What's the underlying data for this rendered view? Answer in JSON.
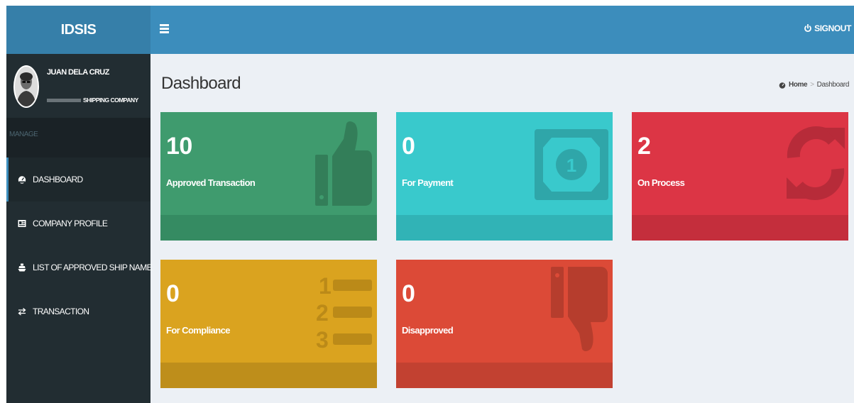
{
  "header": {
    "logo": "IDSIS",
    "signout_label": "SIGNOUT"
  },
  "user": {
    "name": "JUAN DELA CRUZ",
    "company": "SHIPPING COMPANY"
  },
  "sidebar": {
    "section_header": "MANAGE",
    "items": [
      {
        "label": "DASHBOARD",
        "icon": "dashboard-icon",
        "active": true
      },
      {
        "label": "COMPANY PROFILE",
        "icon": "profile-card-icon",
        "active": false
      },
      {
        "label": "LIST OF APPROVED SHIP NAME",
        "icon": "ship-icon",
        "active": false
      },
      {
        "label": "TRANSACTION",
        "icon": "exchange-icon",
        "active": false
      }
    ]
  },
  "content": {
    "title": "Dashboard",
    "breadcrumb": {
      "home": "Home",
      "current": "Dashboard"
    }
  },
  "boxes": [
    {
      "count": "10",
      "label": "Approved Transaction",
      "icon": "thumbs-up-icon",
      "color": "#3f9b6e"
    },
    {
      "count": "0",
      "label": "For Payment",
      "icon": "money-icon",
      "color": "#39c9cc"
    },
    {
      "count": "2",
      "label": "On Process",
      "icon": "refresh-icon",
      "color": "#dc3545"
    },
    {
      "count": "0",
      "label": "For Compliance",
      "icon": "ordered-list-icon",
      "color": "#daa31f"
    },
    {
      "count": "0",
      "label": "Disapproved",
      "icon": "thumbs-down-icon",
      "color": "#dc4a37"
    }
  ],
  "colors": {
    "header": "#3c8dbc",
    "logo_bg": "#367fa9",
    "sidebar": "#222d32",
    "content_bg": "#ecf0f5"
  }
}
